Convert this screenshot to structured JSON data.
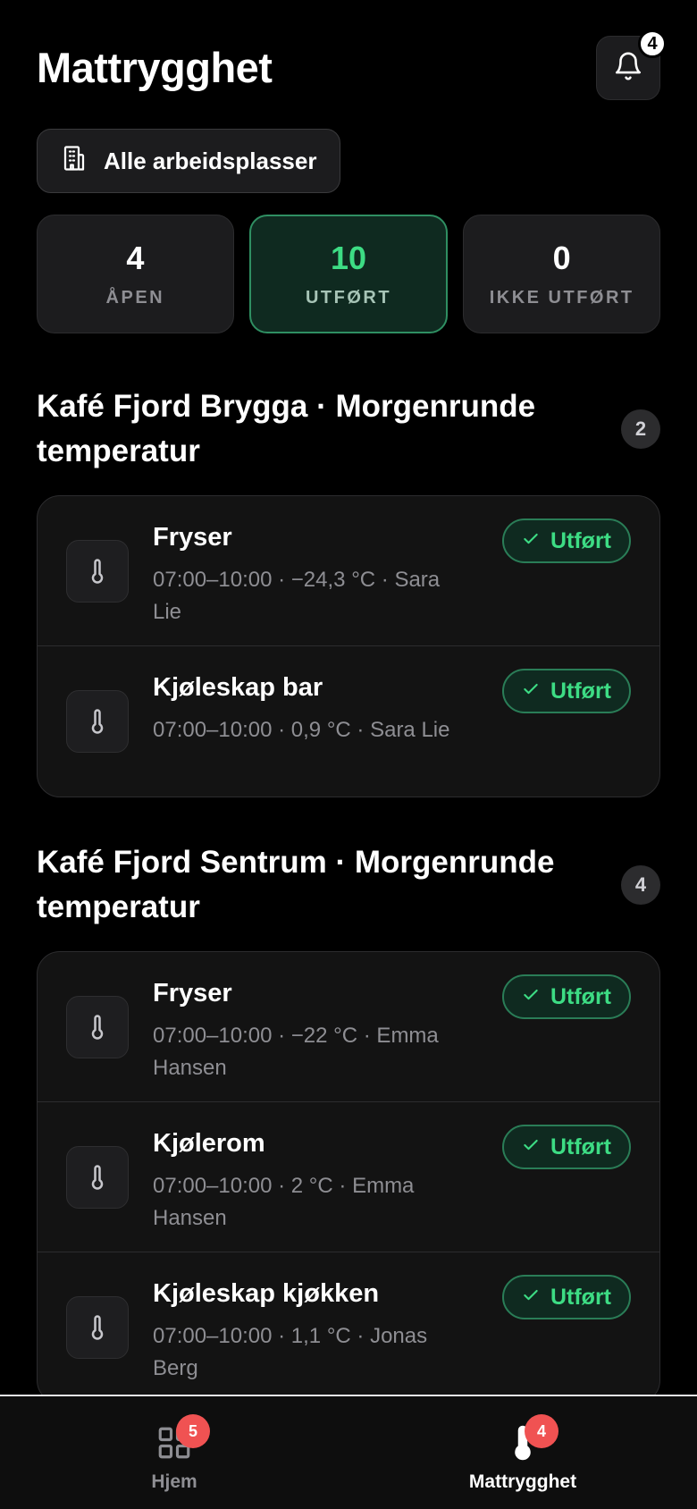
{
  "header": {
    "title": "Mattrygghet",
    "notification_count": "4"
  },
  "workplace_button": {
    "label": "Alle arbeidsplasser"
  },
  "stats": [
    {
      "value": "4",
      "label": "ÅPEN"
    },
    {
      "value": "10",
      "label": "UTFØRT"
    },
    {
      "value": "0",
      "label": "IKKE UTFØRT"
    }
  ],
  "sections": [
    {
      "title": "Kafé Fjord Brygga · Morgenrunde temperatur",
      "count": "2",
      "items": [
        {
          "name": "Fryser",
          "meta": "07:00–10:00 · −24,3 °C · Sara Lie",
          "status": "Utført"
        },
        {
          "name": "Kjøleskap bar",
          "meta": "07:00–10:00 · 0,9 °C · Sara Lie",
          "status": "Utført"
        }
      ]
    },
    {
      "title": "Kafé Fjord Sentrum · Morgenrunde temperatur",
      "count": "4",
      "items": [
        {
          "name": "Fryser",
          "meta": "07:00–10:00 · −22 °C · Emma Hansen",
          "status": "Utført"
        },
        {
          "name": "Kjølerom",
          "meta": "07:00–10:00 · 2 °C · Emma Hansen",
          "status": "Utført"
        },
        {
          "name": "Kjøleskap kjøkken",
          "meta": "07:00–10:00 · 1,1 °C · Jonas Berg",
          "status": "Utført"
        }
      ]
    }
  ],
  "tabbar": {
    "home": {
      "label": "Hjem",
      "badge": "5",
      "icon": "grid-icon"
    },
    "food_safety": {
      "label": "Mattrygghet",
      "badge": "4",
      "icon": "thermometer-icon"
    }
  },
  "colors": {
    "accent_green": "#3ddc84",
    "badge_red": "#f05252",
    "background": "#000000"
  }
}
